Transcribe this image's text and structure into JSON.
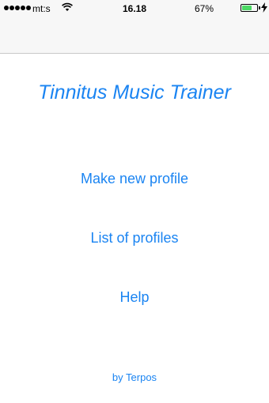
{
  "status_bar": {
    "carrier": "mt:s",
    "time": "16.18",
    "battery_percent": "67%",
    "battery_level": 0.67,
    "signal_dots": 5,
    "icons": [
      "signal-dots-icon",
      "wifi-icon",
      "battery-icon",
      "charging-bolt-icon"
    ]
  },
  "app": {
    "title": "Tinnitus Music Trainer"
  },
  "menu": {
    "new_profile": "Make new profile",
    "list_profiles": "List of profiles",
    "help": "Help"
  },
  "footer": {
    "credit": "by Terpos"
  },
  "colors": {
    "accent": "#1a84f2",
    "battery": "#4cd964",
    "nav_background": "#f7f7f7"
  }
}
